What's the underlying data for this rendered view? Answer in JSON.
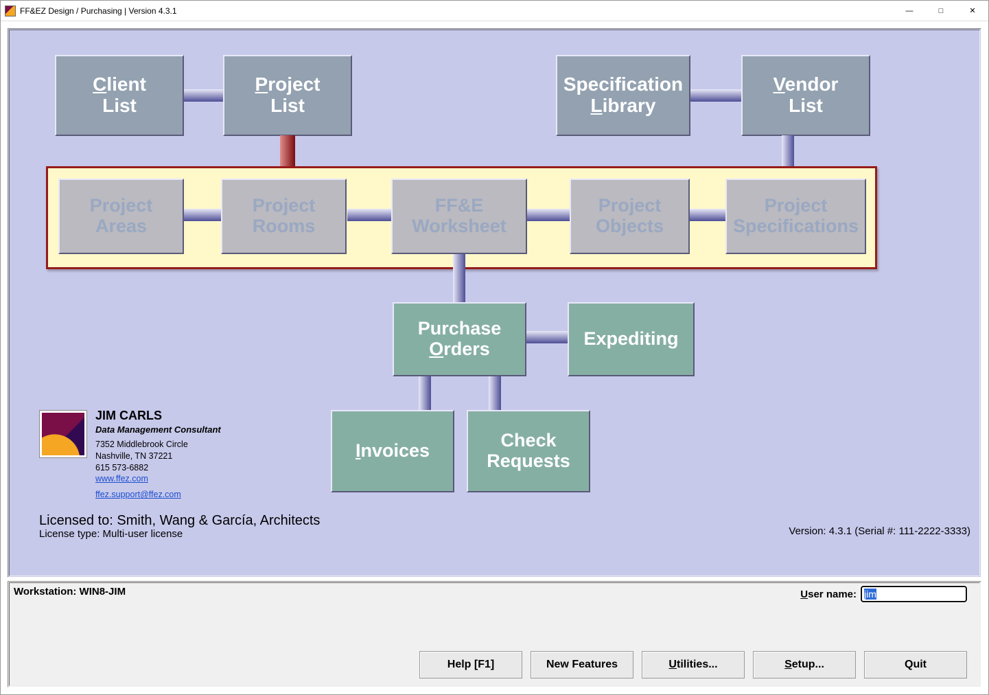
{
  "window": {
    "title": "FF&EZ Design / Purchasing | Version 4.3.1"
  },
  "boxes": {
    "client_list": "Client\nList",
    "project_list": "Project\nList",
    "spec_library": "Specification\nLibrary",
    "vendor_list": "Vendor\nList",
    "project_areas": "Project\nAreas",
    "project_rooms": "Project\nRooms",
    "ffe_worksheet": "FF&E\nWorksheet",
    "project_objects": "Project\nObjects",
    "project_specs": "Project\nSpecifications",
    "purchase_orders": "Purchase\nOrders",
    "expediting": "Expediting",
    "invoices": "Invoices",
    "check_requests": "Check\nRequests"
  },
  "contact": {
    "name": "JIM CARLS",
    "role": "Data Management Consultant",
    "addr1": "7352 Middlebrook Circle",
    "addr2": "Nashville, TN  37221",
    "phone": "615 573-6882",
    "web": "www.ffez.com",
    "email": "ffez.support@ffez.com"
  },
  "license": {
    "line": "Licensed to: Smith, Wang & García, Architects",
    "type": "License type: Multi-user license",
    "version": "Version: 4.3.1  (Serial #: 111-2222-3333)"
  },
  "bottom": {
    "workstation_label": "Workstation: WIN8-JIM",
    "user_label": "User name:",
    "user_value": "jim",
    "buttons": {
      "help": "Help [F1]",
      "new_features": "New Features",
      "utilities": "Utilities...",
      "setup": "Setup...",
      "quit": "Quit"
    }
  }
}
